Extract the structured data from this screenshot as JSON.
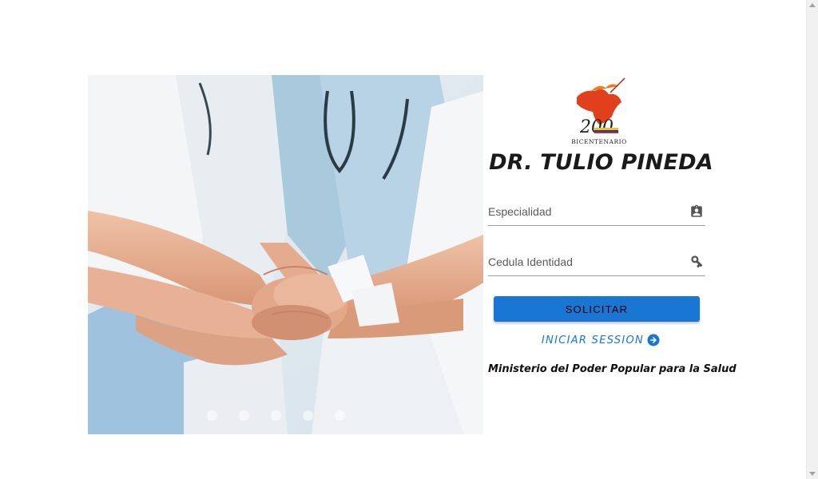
{
  "brand": {
    "logo_text": "BICENTENARIO",
    "logo_numeral": "200",
    "title": "DR. TULIO PINEDA"
  },
  "form": {
    "especialidad": {
      "placeholder": "Especialidad",
      "value": "",
      "icon": "clipboard-account-icon"
    },
    "cedula": {
      "placeholder": "Cedula Identidad",
      "value": "",
      "icon": "key-icon"
    },
    "submit_label": "SOLICITAR",
    "login_link_label": "INICIAR SESSION",
    "login_link_icon": "arrow-right-circle-icon"
  },
  "footer": {
    "text": "Ministerio del Poder Popular para la Salud"
  },
  "carousel": {
    "slide_count": 5,
    "active_index": 0
  },
  "colors": {
    "primary": "#1976d2",
    "title": "#1a1a1a"
  }
}
